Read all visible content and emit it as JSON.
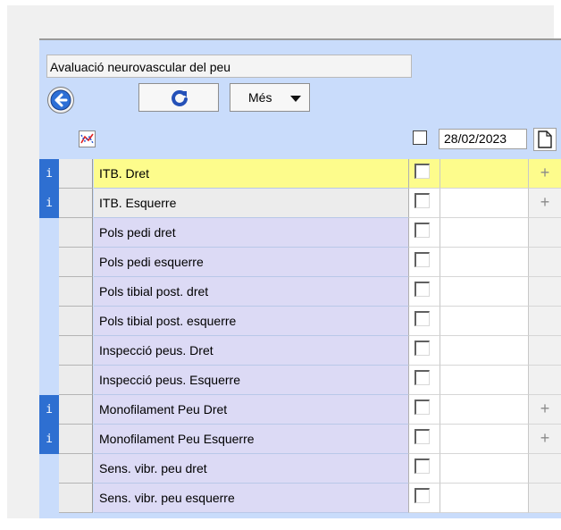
{
  "form": {
    "title": "Avaluació neurovascular del peu",
    "buttons": {
      "back_icon": "arrow-left-circle-icon",
      "refresh_icon": "refresh-icon",
      "more_label": "Més"
    },
    "header": {
      "graph_icon": "line-chart-icon",
      "date": "28/02/2023",
      "new_icon": "new-document-icon"
    }
  },
  "rows": [
    {
      "label": "ITB. Dret",
      "info": "i",
      "plus": "+",
      "highlight": true
    },
    {
      "label": "ITB. Esquerre",
      "info": "i",
      "plus": "+",
      "highlight": false
    },
    {
      "label": "Pols pedi dret",
      "info": "",
      "plus": "",
      "highlight": false
    },
    {
      "label": "Pols pedi esquerre",
      "info": "",
      "plus": "",
      "highlight": false
    },
    {
      "label": "Pols tibial post. dret",
      "info": "",
      "plus": "",
      "highlight": false
    },
    {
      "label": "Pols tibial post. esquerre",
      "info": "",
      "plus": "",
      "highlight": false
    },
    {
      "label": "Inspecció peus. Dret",
      "info": "",
      "plus": "",
      "highlight": false
    },
    {
      "label": "Inspecció peus. Esquerre",
      "info": "",
      "plus": "",
      "highlight": false
    },
    {
      "label": "Monofilament Peu Dret",
      "info": "i",
      "plus": "+",
      "highlight": false
    },
    {
      "label": "Monofilament Peu Esquerre",
      "info": "i",
      "plus": "+",
      "highlight": false
    },
    {
      "label": "Sens. vibr. peu dret",
      "info": "",
      "plus": "",
      "highlight": false
    },
    {
      "label": "Sens. vibr. peu esquerre",
      "info": "",
      "plus": "",
      "highlight": false
    }
  ],
  "colors": {
    "panel": "#c9dcfb",
    "info_badge": "#2e6fd1",
    "highlight_row": "#fdfc8c",
    "label_cell": "#dcdaf5"
  }
}
